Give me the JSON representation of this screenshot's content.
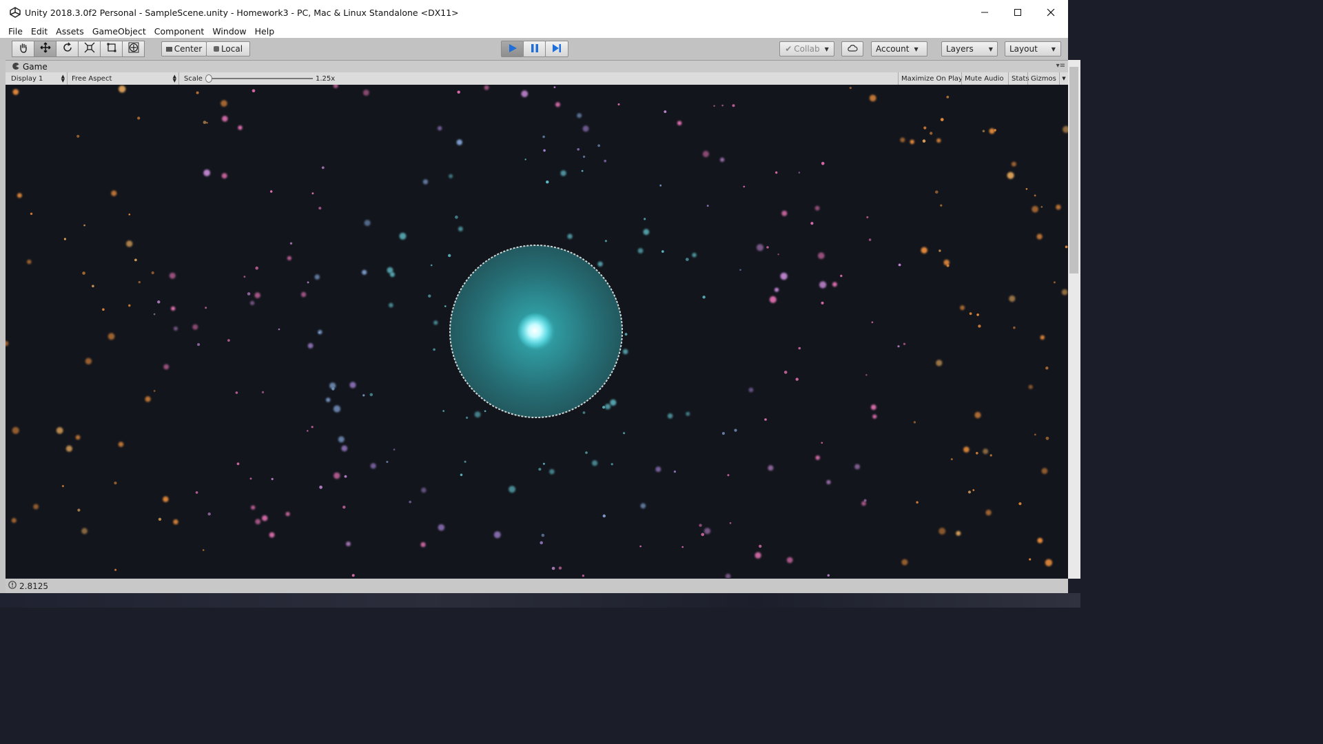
{
  "window": {
    "title": "Unity 2018.3.0f2 Personal - SampleScene.unity - Homework3 - PC, Mac & Linux Standalone <DX11>"
  },
  "menu": [
    "File",
    "Edit",
    "Assets",
    "GameObject",
    "Component",
    "Window",
    "Help"
  ],
  "toolbar": {
    "tools": [
      "hand-icon",
      "move-icon",
      "rotate-icon",
      "scale-icon",
      "rect-icon",
      "transform-icon"
    ],
    "active_tool": "move-icon",
    "pivot_label": "Center",
    "space_label": "Local",
    "play_controls": [
      "play-icon",
      "pause-icon",
      "step-icon"
    ],
    "collab_label": "Collab",
    "account_label": "Account",
    "layers_label": "Layers",
    "layout_label": "Layout",
    "accent_color": "#1e6fd9"
  },
  "game_panel": {
    "tab_label": "Game",
    "display": "Display 1",
    "aspect": "Free Aspect",
    "scale_label": "Scale",
    "scale_value": "1.25x",
    "toggles": [
      "Maximize On Play",
      "Mute Audio",
      "Stats",
      "Gizmos"
    ]
  },
  "status": {
    "text": "2.8125"
  },
  "colors": {
    "background": "#12151c",
    "halo": "#2f8c93",
    "core": "#bff8ff"
  }
}
